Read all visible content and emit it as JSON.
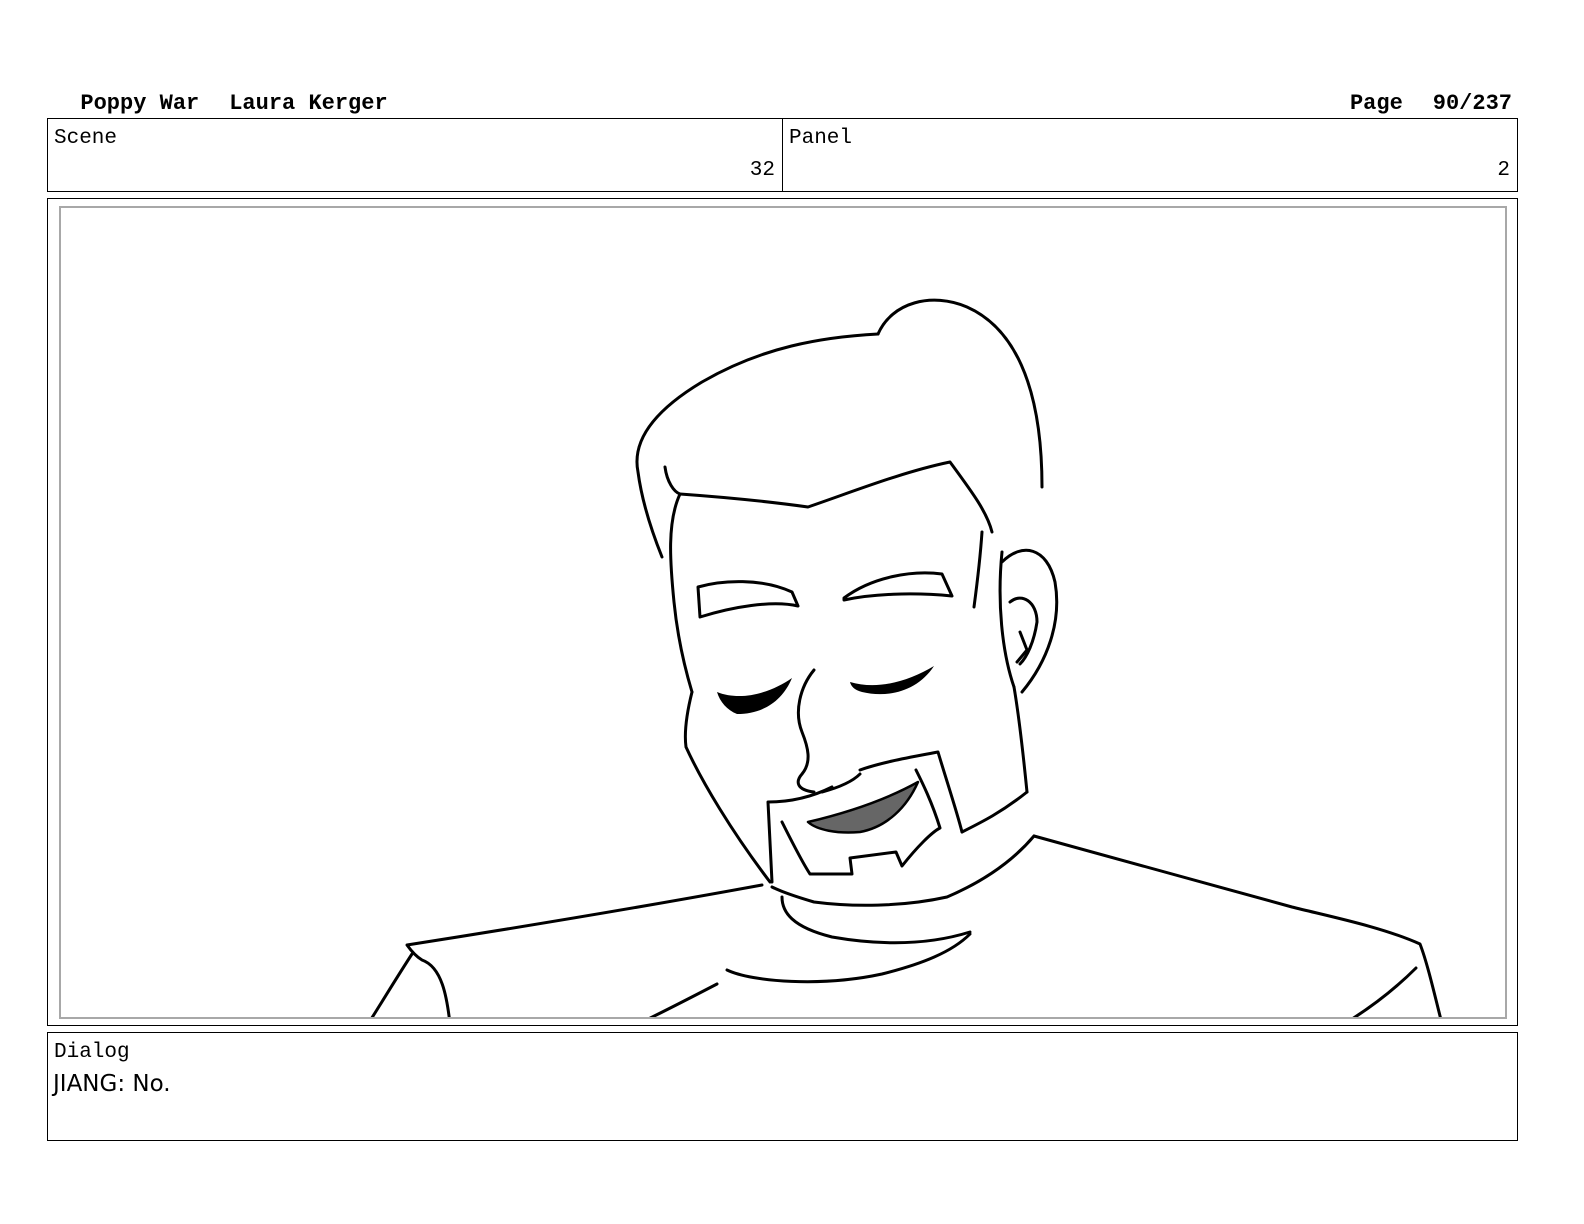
{
  "header": {
    "project_title": "Poppy War",
    "author": "Laura Kerger",
    "page_label": "Page",
    "page_number": "90/237"
  },
  "info": {
    "scene_label": "Scene",
    "scene_value": "32",
    "panel_label": "Panel",
    "panel_value": "2"
  },
  "dialog": {
    "label": "Dialog",
    "text": "JIANG: No."
  }
}
